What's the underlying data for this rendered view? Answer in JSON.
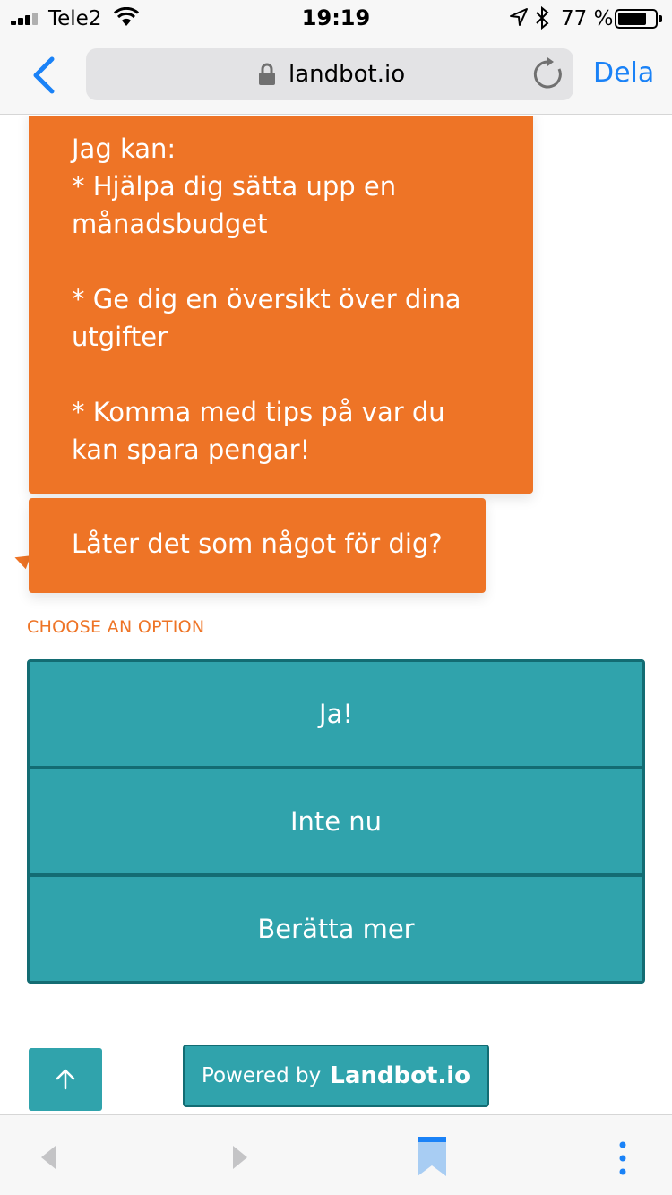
{
  "status": {
    "carrier": "Tele2",
    "time": "19:19",
    "battery_percent": "77 %",
    "battery_level": 0.77
  },
  "browser": {
    "url": "landbot.io",
    "share_label": "Dela"
  },
  "chat": {
    "messages": [
      "Jag kan:\n* Hjälpa dig sätta upp en\nmånadsbudget\n\n* Ge dig en översikt över dina\nutgifter\n\n* Komma med tips på var du\nkan spara pengar!",
      "Låter det som något för dig?"
    ],
    "choose_label": "CHOOSE AN OPTION",
    "options": [
      "Ja!",
      "Inte nu",
      "Berätta mer"
    ],
    "powered_by": "Powered by",
    "brand": "Landbot.io"
  },
  "colors": {
    "bot_bubble": "#ee7426",
    "option_button": "#30a3ac",
    "option_border": "#136c73",
    "ios_blue": "#1a82f7"
  },
  "icons": {
    "signal": "signal-bars-icon",
    "wifi": "wifi-icon",
    "location": "location-arrow-icon",
    "bluetooth": "bluetooth-icon",
    "lock": "lock-icon",
    "reload": "reload-icon",
    "back": "chevron-left-icon",
    "scroll_up": "arrow-up-icon",
    "bookmarks": "bookmark-icon",
    "more": "more-vertical-icon"
  }
}
